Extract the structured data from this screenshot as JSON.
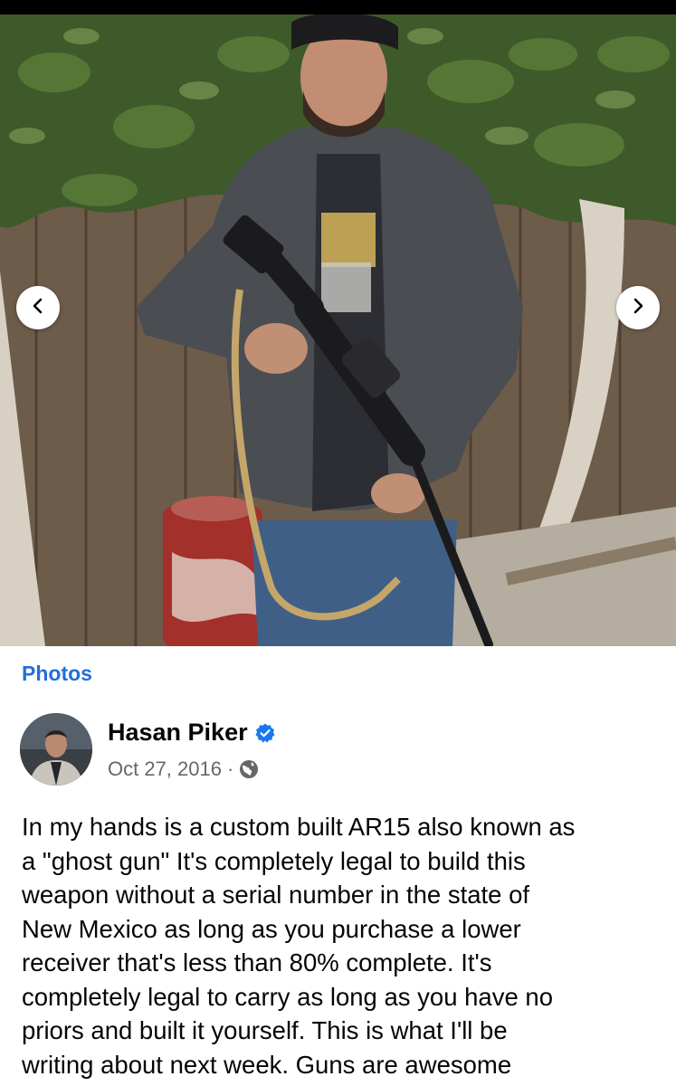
{
  "photo": {
    "prev_icon": "chevron-left-icon",
    "next_icon": "chevron-right-icon"
  },
  "album": {
    "label": "Photos"
  },
  "post": {
    "author": "Hasan Piker",
    "verified_icon": "verified-badge-icon",
    "date": "Oct 27, 2016",
    "separator": "·",
    "privacy_icon": "globe-icon",
    "text_lines": [
      "In my hands is a custom built AR15 also known as",
      "a \"ghost gun\" It's completely legal to build this",
      "weapon without a serial number in the state of",
      "New Mexico as long as you purchase a lower",
      "receiver that's less than 80% complete. It's",
      "completely legal to carry as long as you have no",
      "priors and built it yourself. This is what I'll be",
      "writing about next week. Guns are awesome"
    ]
  },
  "colors": {
    "link_blue": "#216fdb",
    "meta_gray": "#65676b",
    "verified_blue": "#1877f2",
    "text": "#050505"
  }
}
